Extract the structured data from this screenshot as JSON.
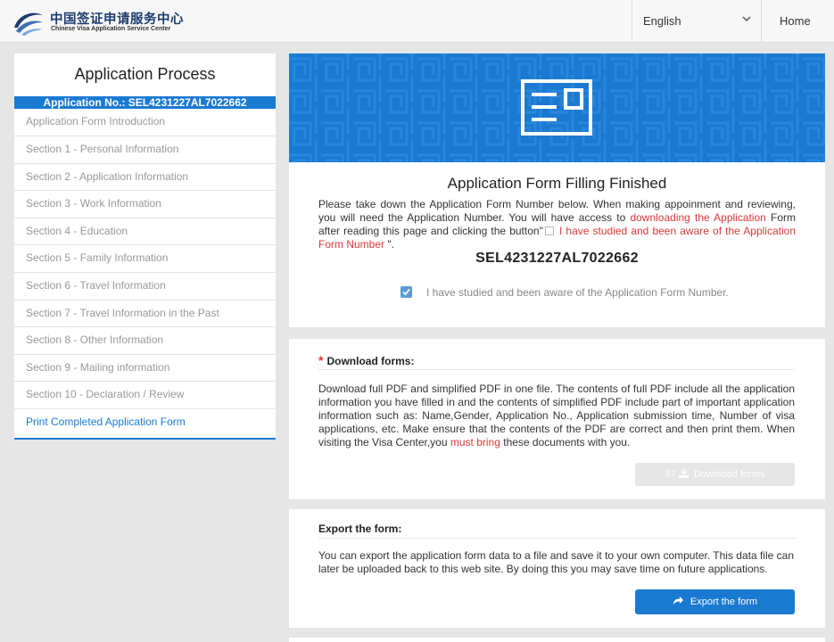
{
  "header": {
    "logo_cn": "中国签证申请服务中心",
    "logo_en": "Chinese Visa Application Service Center",
    "language": "English",
    "home": "Home"
  },
  "sidebar": {
    "title": "Application Process",
    "application_no": "Application No.: SEL4231227AL7022662",
    "items": [
      {
        "label": "Application Form Introduction"
      },
      {
        "label": "Section 1 - Personal Information"
      },
      {
        "label": "Section 2 - Application Information"
      },
      {
        "label": "Section 3 - Work Information"
      },
      {
        "label": "Section 4 - Education"
      },
      {
        "label": "Section 5 - Family Information"
      },
      {
        "label": "Section 6 - Travel Information"
      },
      {
        "label": "Section 7 - Travel Information in the Past"
      },
      {
        "label": "Section 8 - Other Information"
      },
      {
        "label": "Section 9 - Mailing information"
      },
      {
        "label": "Section 10 - Declaration / Review"
      },
      {
        "label": "Print Completed Application Form",
        "active": true
      }
    ]
  },
  "finished": {
    "title": "Application Form Filling Finished",
    "text_1": "Please take down the Application Form Number below. When making appoinment and reviewing, you will need the Application Number. You will have access to ",
    "text_link_1": "downloading the Application",
    "text_2": " Form after reading this page and clicking the button\"",
    "text_link_2": " I have studied and been aware of the Application Form Number",
    "text_3": " \".",
    "form_number": "SEL4231227AL7022662",
    "checkbox_label": "I have studied and been aware of the Application Form Number.",
    "checkbox_checked": true
  },
  "download": {
    "heading": "Download forms:",
    "required_mark": "*",
    "text_1": "Download full PDF and simplified PDF in one file. The contents of full PDF include all the application information you have filled in and the contents of simplified PDF include part of important application information such as: Name,Gender, Application No., Application submission time, Number of visa applications, etc. Make ensure that the contents of the PDF are correct and then print them. When visiting the Visa Center,you ",
    "text_red": "must bring",
    "text_2": " these documents with you.",
    "countdown": "57",
    "button_label": "Download forms",
    "button_enabled": false
  },
  "export": {
    "heading": "Export the form:",
    "text": "You can export the application form data to a file and save it to your own computer. This data file can later be uploaded back to this web site. By doing this you may save time on future applications.",
    "button_label": "Export the form"
  },
  "colors": {
    "brand_blue": "#1a7ad2",
    "link_red": "#d93a3a",
    "page_bg": "#e6e6e6"
  }
}
